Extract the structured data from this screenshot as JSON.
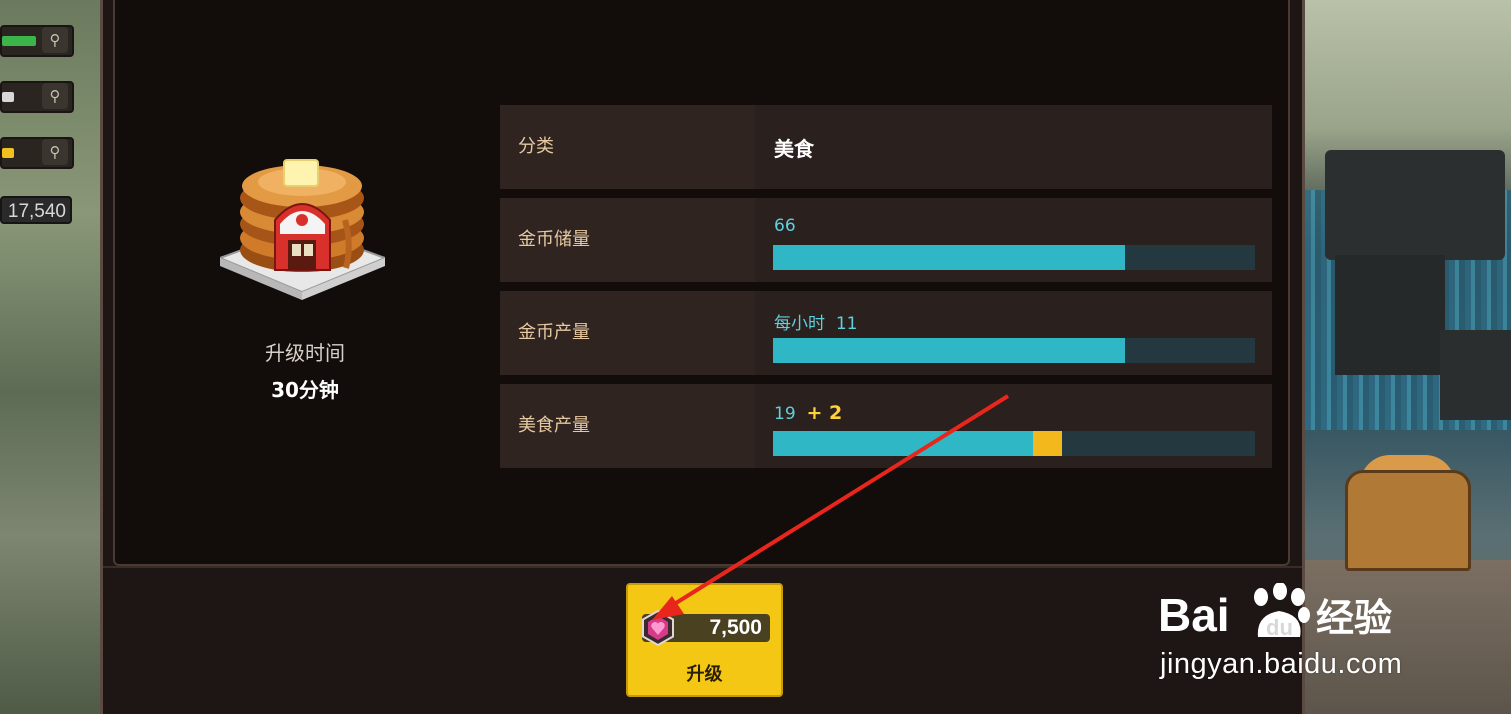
{
  "side": {
    "resource_count": "17,540"
  },
  "building": {
    "upgrade_time_label": "升级时间",
    "upgrade_time_value": "30分钟"
  },
  "stats": [
    {
      "label": "分类",
      "value": "美食"
    },
    {
      "label": "金币储量",
      "value": "66",
      "fill_percent": 73
    },
    {
      "label": "金币产量",
      "prefix": "每小时",
      "value": "11",
      "fill_percent": 73
    },
    {
      "label": "美食产量",
      "value": "19",
      "bonus": "+ 2",
      "fill_percent": 54,
      "bonus_percent": 6
    }
  ],
  "upgrade": {
    "cost": "7,500",
    "label": "升级"
  },
  "watermark": {
    "logo_text": "Bai du 经验",
    "url": "jingyan.baidu.com"
  },
  "colors": {
    "bar_fill": "#2fb7c6",
    "bar_bonus": "#f2b81c",
    "button": "#f3c713",
    "arrow": "#e8261c"
  }
}
